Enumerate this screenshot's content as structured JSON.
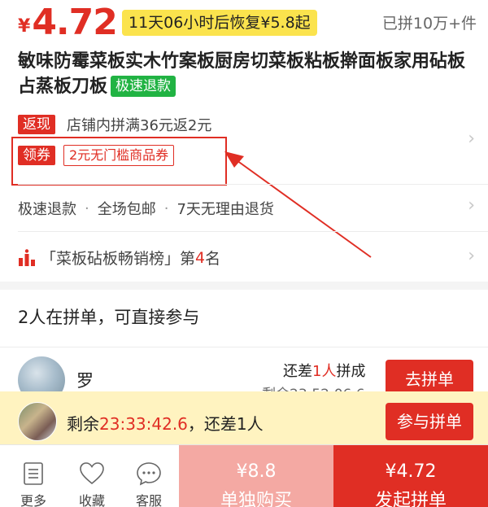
{
  "product": {
    "price_symbol": "¥",
    "price": "4.72",
    "restore_notice": "11天06小时后恢复¥5.8起",
    "sold_count": "已拼10万+件",
    "title": "敏味防霉菜板实木竹案板厨房切菜板粘板擀面板家用砧板占蒸板刀板",
    "fast_refund_tag": "极速退款"
  },
  "promotions": {
    "cashback_tag": "返现",
    "cashback_text": "店铺内拼满36元返2元",
    "coupon_tag": "领券",
    "coupon_text": "2元无门槛商品券"
  },
  "services": {
    "items": [
      "极速退款",
      "全场包邮",
      "7天无理由退货"
    ],
    "separator": "·"
  },
  "ranking": {
    "prefix": "「菜板砧板畅销榜」第",
    "rank": "4",
    "suffix": "名"
  },
  "group": {
    "title": "2人在拼单，可直接参与",
    "member_name": "罗",
    "need_prefix": "还差",
    "need_count": "1人",
    "need_suffix": "拼成",
    "remaining": "剩余23:52:06.6",
    "join_label": "去拼单"
  },
  "floating": {
    "prefix": "剩余",
    "countdown": "23:33:42.6",
    "suffix": "，还差1人",
    "button_label": "参与拼单"
  },
  "bottom": {
    "more_label": "更多",
    "favorite_label": "收藏",
    "service_label": "客服",
    "solo_price": "¥8.8",
    "solo_label": "单独购买",
    "group_price": "¥4.72",
    "group_label": "发起拼单"
  },
  "colors": {
    "accent": "#e02e24",
    "badge_yellow": "#fbe34d",
    "green_tag": "#21b343",
    "solo_button": "#f4a9a3",
    "floating_bg": "#fff3c0"
  }
}
